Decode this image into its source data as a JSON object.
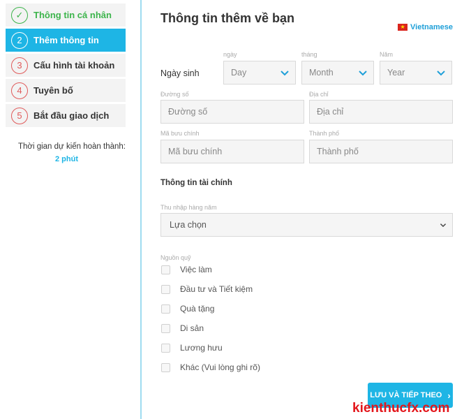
{
  "sidebar": {
    "steps": [
      {
        "num": "✓",
        "label": "Thông tin cá nhân",
        "state": "done"
      },
      {
        "num": "2",
        "label": "Thêm thông tin",
        "state": "active"
      },
      {
        "num": "3",
        "label": "Cấu hình tài khoản",
        "state": "pending"
      },
      {
        "num": "4",
        "label": "Tuyên bố",
        "state": "pending"
      },
      {
        "num": "5",
        "label": "Bắt đầu giao dịch",
        "state": "pending"
      }
    ],
    "estimate_label": "Thời gian dự kiến hoàn thành:",
    "estimate_value": "2 phút"
  },
  "header": {
    "title": "Thông tin thêm về bạn",
    "language": "Vietnamese",
    "flag_icon": "vietnam-flag-icon"
  },
  "dob": {
    "label": "Ngày sinh",
    "day_label": "ngày",
    "day_value": "Day",
    "month_label": "tháng",
    "month_value": "Month",
    "year_label": "Năm",
    "year_value": "Year"
  },
  "address": {
    "street_label": "Đường số",
    "street_placeholder": "Đường số",
    "address_label": "Địa chỉ",
    "address_placeholder": "Địa chỉ",
    "postal_label": "Mã bưu chính",
    "postal_placeholder": "Mã bưu chính",
    "city_label": "Thành phố",
    "city_placeholder": "Thành phố"
  },
  "finance": {
    "section_title": "Thông tin tài chính",
    "income_label": "Thu nhập hàng năm",
    "income_value": "Lựa chọn",
    "source_label": "Nguồn quỹ",
    "sources": [
      "Việc làm",
      "Đầu tư và Tiết kiệm",
      "Quà tặng",
      "Di sản",
      "Lương hưu",
      "Khác (Vui lòng ghi rõ)"
    ]
  },
  "actions": {
    "save_label": "LƯU VÀ TIẾP THEO",
    "save_arrow": "›"
  },
  "watermark": "kienthucfx.com",
  "colors": {
    "accent": "#1eb5e5",
    "done": "#3cb44b",
    "pending": "#e05a5a",
    "watermark": "#e3161b"
  }
}
